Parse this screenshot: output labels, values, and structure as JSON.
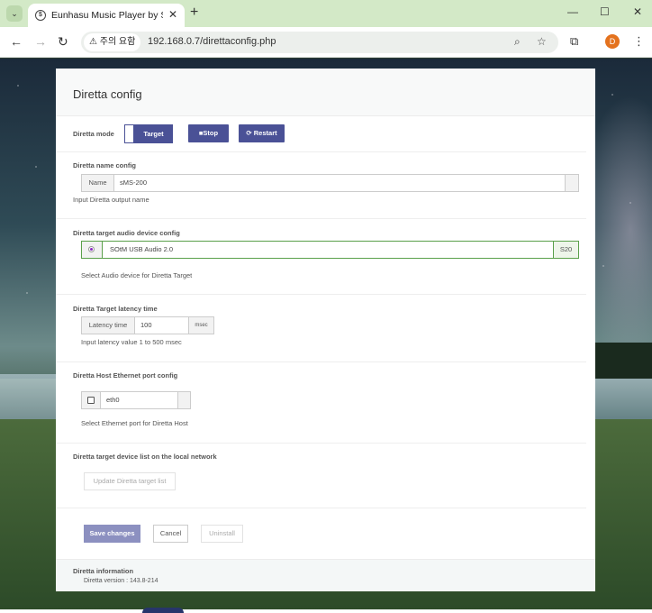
{
  "browser": {
    "tab_title": "Eunhasu Music Player by SOtM",
    "security_chip": "주의 요함",
    "url": "192.168.0.7/direttaconfig.php",
    "profile_initial": "D",
    "icons": [
      "tab-search-icon",
      "close-icon",
      "new-tab-icon",
      "minimize-icon",
      "maximize-icon",
      "window-close-icon",
      "back-icon",
      "forward-icon",
      "reload-icon",
      "warning-icon",
      "zoom-icon",
      "bookmark-star-icon",
      "extensions-icon",
      "menu-kebab-icon"
    ]
  },
  "panel": {
    "title": "Diretta config",
    "mode": {
      "label": "Diretta mode",
      "toggle_label": "Target",
      "stop_label": "Stop",
      "restart_label": "Restart"
    },
    "name_config": {
      "label": "Diretta name config",
      "addon": "Name",
      "value": "sMS-200",
      "hint": "Input Diretta output name"
    },
    "audio_device": {
      "label": "Diretta target audio device config",
      "device_name": "SOtM USB Audio 2.0",
      "device_suffix": "S20",
      "hint": "Select Audio device for Diretta Target"
    },
    "latency": {
      "label": "Diretta Target latency time",
      "addon": "Latency time",
      "value": "100",
      "unit": "msec",
      "hint": "Input latency value 1 to 500 msec"
    },
    "ethernet": {
      "label": "Diretta Host Ethernet port config",
      "port": "eth0",
      "hint": "Select Ethernet port for Diretta Host"
    },
    "device_list": {
      "label": "Diretta target device list on the local network",
      "update_label": "Update Diretta target list"
    },
    "actions": {
      "save_label": "Save changes",
      "cancel_label": "Cancel",
      "uninstall_label": "Uninstall"
    },
    "info": {
      "label": "Diretta information",
      "version": "Diretta version : 143.8-214"
    }
  },
  "colors": {
    "tabbar": "#d3e9c7",
    "accent_navy": "#4a5196",
    "save_button": "#8c90c0",
    "green_border": "#5aa04a",
    "profile": "#e4721e"
  }
}
